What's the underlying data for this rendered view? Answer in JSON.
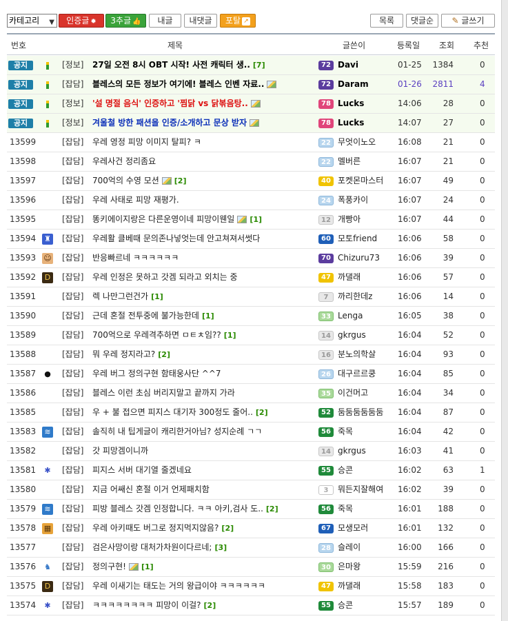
{
  "toolbar": {
    "category_select": "카테고리",
    "certified_button": "인증글",
    "recommend_button": "3추글",
    "my_posts_button": "내글",
    "my_comments_button": "내댓글",
    "portal_button": "포탈",
    "list_button": "목록",
    "comment_order_button": "댓글순",
    "write_button": "글쓰기"
  },
  "columns": {
    "number": "번호",
    "title": "제목",
    "writer": "글쓴이",
    "date": "등록일",
    "views": "조회",
    "recommend": "추천"
  },
  "notice_badge": "공지",
  "posts": [
    {
      "no": "",
      "notice": true,
      "icon": "level-bar",
      "cat": "[정보]",
      "title": "27일 오전 8시 OBT 시작! 사전 캐릭터 생..",
      "style": "bold",
      "img": false,
      "comments": "[7]",
      "level": "72",
      "lv_color": "purple",
      "writer": "Davi",
      "writer_bold": true,
      "date": "01-25",
      "views": "1384",
      "rec": "0",
      "hl": false
    },
    {
      "no": "",
      "notice": true,
      "icon": "level-bar",
      "cat": "[잡담]",
      "title": "블레스의 모든 정보가 여기에! 블레스 인벤 자료..",
      "style": "bold",
      "img": true,
      "comments": "",
      "level": "72",
      "lv_color": "purple",
      "writer": "Daram",
      "writer_bold": true,
      "date": "01-26",
      "views": "2811",
      "rec": "4",
      "hl": true
    },
    {
      "no": "",
      "notice": true,
      "icon": "level-bar",
      "cat": "[정보]",
      "title": "'설 명절 음식' 인증하고 '찜닭 vs 닭볶음탕..",
      "style": "red",
      "img": true,
      "comments": "",
      "level": "78",
      "lv_color": "pink",
      "writer": "Lucks",
      "writer_bold": true,
      "date": "14:06",
      "views": "28",
      "rec": "0",
      "hl": false
    },
    {
      "no": "",
      "notice": true,
      "icon": "level-bar",
      "cat": "[정보]",
      "title": "겨울철 방한 패션을 인증/소개하고 문상 받자",
      "style": "blue",
      "img": true,
      "comments": "",
      "level": "78",
      "lv_color": "pink",
      "writer": "Lucks",
      "writer_bold": true,
      "date": "14:07",
      "views": "27",
      "rec": "0",
      "hl": false
    },
    {
      "no": "13599",
      "notice": false,
      "icon": "",
      "cat": "[잡담]",
      "title": "우레 영정 피망 이미지 탈피? ㅋ",
      "style": "",
      "img": false,
      "comments": "",
      "level": "22",
      "lv_color": "lightblue",
      "writer": "무엇이노오",
      "writer_bold": false,
      "date": "16:08",
      "views": "21",
      "rec": "0",
      "hl": false
    },
    {
      "no": "13598",
      "notice": false,
      "icon": "",
      "cat": "[잡담]",
      "title": "우레사건 정리좀요",
      "style": "",
      "img": false,
      "comments": "",
      "level": "22",
      "lv_color": "lightblue",
      "writer": "멜버른",
      "writer_bold": false,
      "date": "16:07",
      "views": "21",
      "rec": "0",
      "hl": false
    },
    {
      "no": "13597",
      "notice": false,
      "icon": "",
      "cat": "[잡담]",
      "title": "700억의 수영 모션",
      "style": "",
      "img": true,
      "comments": "[2]",
      "level": "40",
      "lv_color": "yellow",
      "writer": "포켓몬마스터",
      "writer_bold": false,
      "date": "16:07",
      "views": "49",
      "rec": "0",
      "hl": false
    },
    {
      "no": "13596",
      "notice": false,
      "icon": "",
      "cat": "[잡담]",
      "title": "우레 사태로 피망 재평가.",
      "style": "",
      "img": false,
      "comments": "",
      "level": "24",
      "lv_color": "lightblue",
      "writer": "폭풍카이",
      "writer_bold": false,
      "date": "16:07",
      "views": "24",
      "rec": "0",
      "hl": false
    },
    {
      "no": "13595",
      "notice": false,
      "icon": "",
      "cat": "[잡담]",
      "title": "똥키에이지랑은 다른운영이네 피망이웬일",
      "style": "",
      "img": true,
      "comments": "[1]",
      "level": "12",
      "lv_color": "gray",
      "writer": "개빵아",
      "writer_bold": false,
      "date": "16:07",
      "views": "44",
      "rec": "0",
      "hl": false
    },
    {
      "no": "13594",
      "notice": false,
      "icon": "robot-avatar",
      "cat": "[잡담]",
      "title": "우레활 클베때 문의존나넣엇는데 안고쳐져서썻다",
      "style": "",
      "img": false,
      "comments": "",
      "level": "60",
      "lv_color": "blue",
      "writer": "모토friend",
      "writer_bold": false,
      "date": "16:06",
      "views": "58",
      "rec": "0",
      "hl": false
    },
    {
      "no": "13593",
      "notice": false,
      "icon": "face-avatar",
      "cat": "[잡담]",
      "title": "반응빠르네 ㅋㅋㅋㅋㅋㅋ",
      "style": "",
      "img": false,
      "comments": "",
      "level": "70",
      "lv_color": "purple",
      "writer": "Chizuru73",
      "writer_bold": false,
      "date": "16:06",
      "views": "39",
      "rec": "0",
      "hl": false
    },
    {
      "no": "13592",
      "notice": false,
      "icon": "d-avatar",
      "cat": "[잡담]",
      "title": "우레 인정은 못하고 갓겜 되라고 외치는 중",
      "style": "",
      "img": false,
      "comments": "",
      "level": "47",
      "lv_color": "yellow",
      "writer": "까댈래",
      "writer_bold": false,
      "date": "16:06",
      "views": "57",
      "rec": "0",
      "hl": false
    },
    {
      "no": "13591",
      "notice": false,
      "icon": "",
      "cat": "[잡담]",
      "title": "렉 나만그런건가",
      "style": "",
      "img": false,
      "comments": "[1]",
      "level": "7",
      "lv_color": "gray",
      "writer": "까리한데z",
      "writer_bold": false,
      "date": "16:06",
      "views": "14",
      "rec": "0",
      "hl": false
    },
    {
      "no": "13590",
      "notice": false,
      "icon": "",
      "cat": "[잡담]",
      "title": "근데 혼절 전투중에 불가능한데",
      "style": "",
      "img": false,
      "comments": "[1]",
      "level": "33",
      "lv_color": "lightgreen",
      "writer": "Lenga",
      "writer_bold": false,
      "date": "16:05",
      "views": "38",
      "rec": "0",
      "hl": false
    },
    {
      "no": "13589",
      "notice": false,
      "icon": "",
      "cat": "[잡담]",
      "title": "700억으로 우레격추하면 ㅁㅌㅊ임??",
      "style": "",
      "img": false,
      "comments": "[1]",
      "level": "14",
      "lv_color": "gray",
      "writer": "gkrgus",
      "writer_bold": false,
      "date": "16:04",
      "views": "52",
      "rec": "0",
      "hl": false
    },
    {
      "no": "13588",
      "notice": false,
      "icon": "",
      "cat": "[잡담]",
      "title": "뭐 우레 정지라고?",
      "style": "",
      "img": false,
      "comments": "[2]",
      "level": "16",
      "lv_color": "gray",
      "writer": "분노의학살",
      "writer_bold": false,
      "date": "16:04",
      "views": "93",
      "rec": "0",
      "hl": false
    },
    {
      "no": "13587",
      "notice": false,
      "icon": "panda-avatar",
      "cat": "[잡담]",
      "title": "우레 버그 정의구현 함태웅사단 ^^7",
      "style": "",
      "img": false,
      "comments": "",
      "level": "26",
      "lv_color": "lightblue",
      "writer": "대구르르쿵",
      "writer_bold": false,
      "date": "16:04",
      "views": "85",
      "rec": "0",
      "hl": false
    },
    {
      "no": "13586",
      "notice": false,
      "icon": "",
      "cat": "[잡담]",
      "title": "블레스 이런 초심 버리지말고 끝까지 가라",
      "style": "",
      "img": false,
      "comments": "",
      "level": "35",
      "lv_color": "lightgreen",
      "writer": "이건머고",
      "writer_bold": false,
      "date": "16:04",
      "views": "34",
      "rec": "0",
      "hl": false
    },
    {
      "no": "13585",
      "notice": false,
      "icon": "",
      "cat": "[잡담]",
      "title": "우 + 불 접으면 피지스 대기자 300정도 줄어..",
      "style": "",
      "img": false,
      "comments": "[2]",
      "level": "52",
      "lv_color": "green",
      "writer": "둠둠둠둠둠둠",
      "writer_bold": false,
      "date": "16:04",
      "views": "87",
      "rec": "0",
      "hl": false
    },
    {
      "no": "13583",
      "notice": false,
      "icon": "wave-avatar",
      "cat": "[잡담]",
      "title": "솔직히 내 팁게글이 캐리한거아님? 성지순례 ㄱㄱ",
      "style": "",
      "img": false,
      "comments": "",
      "level": "56",
      "lv_color": "green",
      "writer": "죽목",
      "writer_bold": false,
      "date": "16:04",
      "views": "42",
      "rec": "0",
      "hl": false
    },
    {
      "no": "13582",
      "notice": false,
      "icon": "",
      "cat": "[잡담]",
      "title": "갓 피망겜이니까",
      "style": "",
      "img": false,
      "comments": "",
      "level": "14",
      "lv_color": "gray",
      "writer": "gkrgus",
      "writer_bold": false,
      "date": "16:03",
      "views": "41",
      "rec": "0",
      "hl": false
    },
    {
      "no": "13581",
      "notice": false,
      "icon": "creature-avatar",
      "cat": "[잡담]",
      "title": "피지스 서버 대기열 줄겠네요",
      "style": "",
      "img": false,
      "comments": "",
      "level": "55",
      "lv_color": "green",
      "writer": "승콘",
      "writer_bold": false,
      "date": "16:02",
      "views": "63",
      "rec": "1",
      "hl": false
    },
    {
      "no": "13580",
      "notice": false,
      "icon": "",
      "cat": "[잡담]",
      "title": "지금 어쌔신 혼절 이거 언제패치함",
      "style": "",
      "img": false,
      "comments": "",
      "level": "3",
      "lv_color": "white",
      "writer": "뭐든지잘해여",
      "writer_bold": false,
      "date": "16:02",
      "views": "39",
      "rec": "0",
      "hl": false
    },
    {
      "no": "13579",
      "notice": false,
      "icon": "wave-avatar",
      "cat": "[잡담]",
      "title": "피방 블레스 갓겜 인정합니다. ㅋㅋ 아키,검사 도..",
      "style": "",
      "img": false,
      "comments": "[2]",
      "level": "56",
      "lv_color": "green",
      "writer": "죽목",
      "writer_bold": false,
      "date": "16:01",
      "views": "188",
      "rec": "0",
      "hl": false
    },
    {
      "no": "13578",
      "notice": false,
      "icon": "grid-avatar",
      "cat": "[잡담]",
      "title": "우레 아키때도 버그로 정지먹지않음?",
      "style": "",
      "img": false,
      "comments": "[2]",
      "level": "67",
      "lv_color": "blue",
      "writer": "모생모러",
      "writer_bold": false,
      "date": "16:01",
      "views": "132",
      "rec": "0",
      "hl": false
    },
    {
      "no": "13577",
      "notice": false,
      "icon": "",
      "cat": "[잡담]",
      "title": "검은사망이랑 대처가차원이다르네;",
      "style": "",
      "img": false,
      "comments": "[3]",
      "level": "28",
      "lv_color": "lightblue",
      "writer": "슬레이",
      "writer_bold": false,
      "date": "16:00",
      "views": "166",
      "rec": "0",
      "hl": false
    },
    {
      "no": "13576",
      "notice": false,
      "icon": "creature2-avatar",
      "cat": "[잡담]",
      "title": "정의구현!",
      "style": "",
      "img": true,
      "comments": "[1]",
      "level": "30",
      "lv_color": "lightgreen",
      "writer": "은마왕",
      "writer_bold": false,
      "date": "15:59",
      "views": "216",
      "rec": "0",
      "hl": false
    },
    {
      "no": "13575",
      "notice": false,
      "icon": "d-avatar",
      "cat": "[잡담]",
      "title": "우레 이새기는 태도는 거의 왕급이야 ㅋㅋㅋㅋㅋㅋ",
      "style": "",
      "img": false,
      "comments": "",
      "level": "47",
      "lv_color": "yellow",
      "writer": "까댈래",
      "writer_bold": false,
      "date": "15:58",
      "views": "183",
      "rec": "0",
      "hl": false
    },
    {
      "no": "13574",
      "notice": false,
      "icon": "creature-avatar",
      "cat": "[잡담]",
      "title": "ㅋㅋㅋㅋㅋㅋㅋㅋ 피망이 이걸?",
      "style": "",
      "img": false,
      "comments": "[2]",
      "level": "55",
      "lv_color": "green",
      "writer": "승콘",
      "writer_bold": false,
      "date": "15:57",
      "views": "189",
      "rec": "0",
      "hl": false
    }
  ]
}
